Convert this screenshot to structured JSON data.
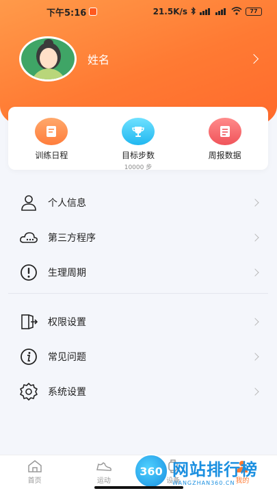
{
  "status_bar": {
    "time": "下午5:16",
    "net_speed": "21.5K/s",
    "battery": "77"
  },
  "profile": {
    "name": "姓名"
  },
  "quick_actions": [
    {
      "label": "训练日程",
      "sub": ""
    },
    {
      "label": "目标步数",
      "sub": "10000 步"
    },
    {
      "label": "周报数据",
      "sub": ""
    }
  ],
  "menu_group_1": [
    {
      "label": "个人信息",
      "icon": "person-icon"
    },
    {
      "label": "第三方程序",
      "icon": "cloud-icon"
    },
    {
      "label": "生理周期",
      "icon": "alert-circle-icon"
    }
  ],
  "menu_group_2": [
    {
      "label": "权限设置",
      "icon": "door-icon"
    },
    {
      "label": "常见问题",
      "icon": "info-icon"
    },
    {
      "label": "系统设置",
      "icon": "gear-icon"
    }
  ],
  "tabbar": [
    {
      "label": "首页",
      "icon": "home-icon"
    },
    {
      "label": "运动",
      "icon": "shoe-icon"
    },
    {
      "label": "设备",
      "icon": "watch-icon"
    },
    {
      "label": "我的",
      "icon": "user-icon"
    }
  ],
  "watermark": {
    "logo": "360",
    "title": "网站排行榜",
    "sub": "WANGZHAN360.CN"
  },
  "colors": {
    "accent": "#ff7a33",
    "background": "#f4f6fb"
  }
}
